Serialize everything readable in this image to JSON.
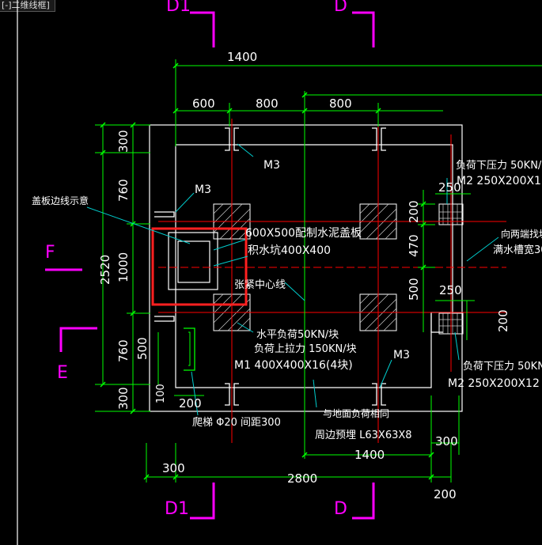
{
  "viewport": {
    "tab_label": "[-]二维线框]"
  },
  "colors": {
    "background": "#000000",
    "dim": "#00ff00",
    "outline": "#ffffff",
    "axis": "#ff0000",
    "leader": "#00cccc",
    "grid_label": "#ff00ff",
    "highlight": "#ff2020",
    "text": "#ffffff"
  },
  "grid_labels": {
    "top_left": "D1",
    "top_right": "D",
    "bottom_left": "D1",
    "bottom_right": "D",
    "left_upper": "F",
    "left_lower": "E"
  },
  "dimensions": {
    "top_overall": "1400",
    "top_left": "600",
    "top_mid": "800",
    "top_right": "800",
    "left_300_top": "300",
    "left_760_top": "760",
    "left_2520": "2520",
    "left_1000": "1000",
    "left_760_bottom": "760",
    "left_500": "500",
    "left_300_bottom": "300",
    "left_100": "100",
    "bottom_300": "300",
    "bottom_2800": "2800",
    "bottom_200": "200",
    "bottom_1400": "1400",
    "bottom_300_right": "300",
    "bottom_200_ladder": "200",
    "inner_200": "200",
    "inner_470": "470",
    "inner_500": "500",
    "pad_250_top": "250",
    "pad_250_bottom": "250",
    "pad_200": "200"
  },
  "annotations": {
    "m3_top": "M3",
    "m3_left": "M3",
    "m3_bottom": "M3",
    "cover_edge": "盖板边线示意",
    "cover_plate": "600X500配制水泥盖板",
    "sump": "积水坑400X400",
    "centerline": "张紧中心线",
    "h_load": "水平负荷50KN/块",
    "uplift": "负荷上拉力 150KN/块",
    "m1": "M1 400X400X16(4块)",
    "down_top": "负荷下压力 50KN/",
    "m2_top": "M2 250X200X1",
    "slope_1": "向两端找坡",
    "slope_2": "满水槽宽30",
    "down_bottom": "负荷下压力 50KN",
    "m2_bottom": "M2 250X200X12",
    "ladder": "爬梯 Φ20 间距300",
    "flush": "与地面负荷相同",
    "angle": "周边预埋 L63X63X8"
  }
}
